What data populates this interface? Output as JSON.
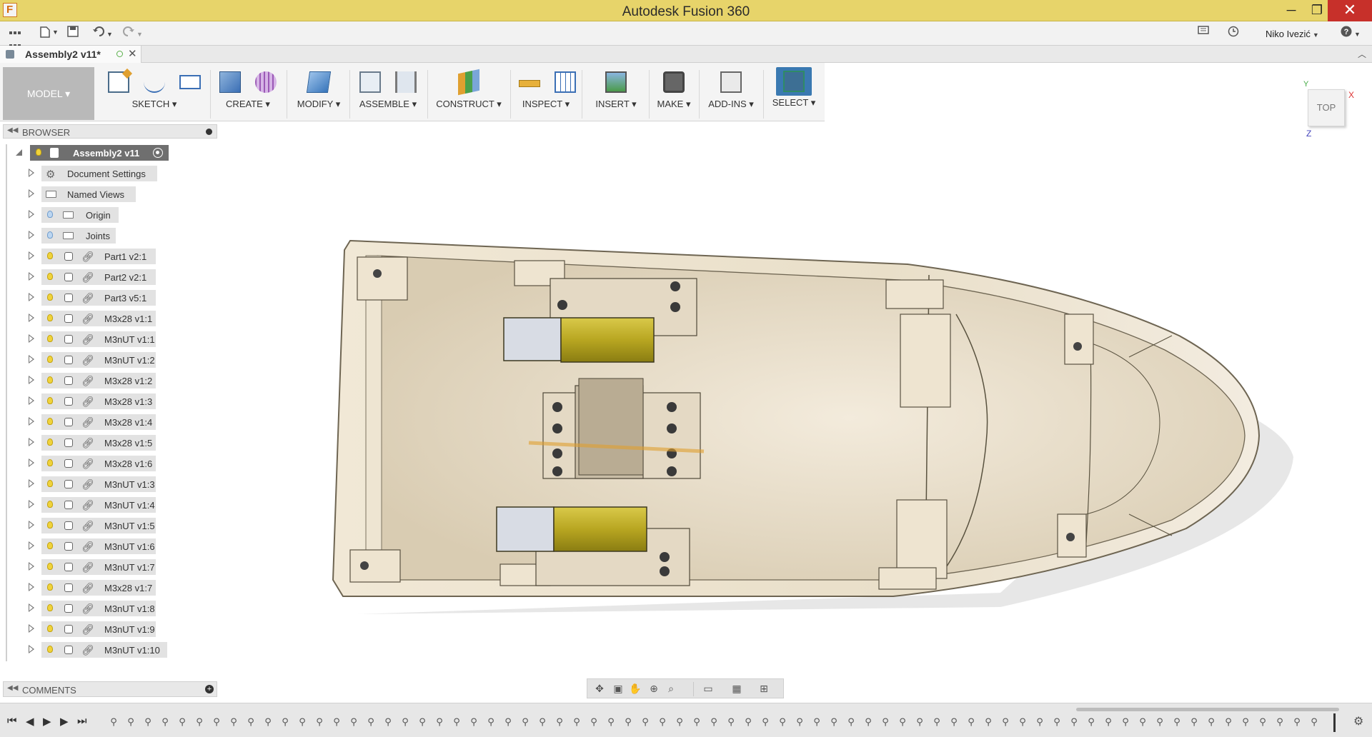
{
  "app": {
    "title": "Autodesk Fusion 360",
    "window_buttons": {
      "minimize": "─",
      "maximize": "❐",
      "close": "✕"
    }
  },
  "quick_access": {
    "user_name": "Niko Ivezić",
    "icons": [
      "grid-icon",
      "file-icon",
      "save-icon",
      "undo-icon",
      "redo-icon",
      "comment-icon",
      "history-icon",
      "help-icon"
    ]
  },
  "document_tab": {
    "name": "Assembly2 v11*",
    "close": "✕"
  },
  "ribbon": {
    "workspace": "MODEL ▾",
    "groups": [
      {
        "label": "SKETCH ▾"
      },
      {
        "label": "CREATE ▾"
      },
      {
        "label": "MODIFY ▾"
      },
      {
        "label": "ASSEMBLE ▾"
      },
      {
        "label": "CONSTRUCT ▾"
      },
      {
        "label": "INSPECT ▾"
      },
      {
        "label": "INSERT ▾"
      },
      {
        "label": "MAKE ▾"
      },
      {
        "label": "ADD-INS ▾"
      },
      {
        "label": "SELECT ▾"
      }
    ]
  },
  "browser": {
    "title": "BROWSER",
    "root": "Assembly2 v11",
    "items": [
      {
        "label": "Document Settings",
        "type": "settings"
      },
      {
        "label": "Named Views",
        "type": "folder"
      },
      {
        "label": "Origin",
        "type": "folder"
      },
      {
        "label": "Joints",
        "type": "folder"
      },
      {
        "label": "Part1 v2:1",
        "type": "link"
      },
      {
        "label": "Part2 v2:1",
        "type": "link"
      },
      {
        "label": "Part3 v5:1",
        "type": "link"
      },
      {
        "label": "M3x28 v1:1",
        "type": "link"
      },
      {
        "label": "M3nUT v1:1",
        "type": "link"
      },
      {
        "label": "M3nUT v1:2",
        "type": "link"
      },
      {
        "label": "M3x28 v1:2",
        "type": "link"
      },
      {
        "label": "M3x28 v1:3",
        "type": "link"
      },
      {
        "label": "M3x28 v1:4",
        "type": "link"
      },
      {
        "label": "M3x28 v1:5",
        "type": "link"
      },
      {
        "label": "M3x28 v1:6",
        "type": "link"
      },
      {
        "label": "M3nUT v1:3",
        "type": "link"
      },
      {
        "label": "M3nUT v1:4",
        "type": "link"
      },
      {
        "label": "M3nUT v1:5",
        "type": "link"
      },
      {
        "label": "M3nUT v1:6",
        "type": "link"
      },
      {
        "label": "M3nUT v1:7",
        "type": "link"
      },
      {
        "label": "M3x28 v1:7",
        "type": "link"
      },
      {
        "label": "M3nUT v1:8",
        "type": "link"
      },
      {
        "label": "M3nUT v1:9",
        "type": "link"
      },
      {
        "label": "M3nUT v1:10",
        "type": "link"
      }
    ]
  },
  "viewcube": {
    "face": "TOP",
    "x": "X",
    "y": "Y",
    "z": "Z"
  },
  "comments": {
    "title": "COMMENTS"
  },
  "colors": {
    "titlebar": "#e7d46a",
    "hull": "#efe4cf",
    "motor": "#c1b12a",
    "select_active": "#3a79b1"
  }
}
